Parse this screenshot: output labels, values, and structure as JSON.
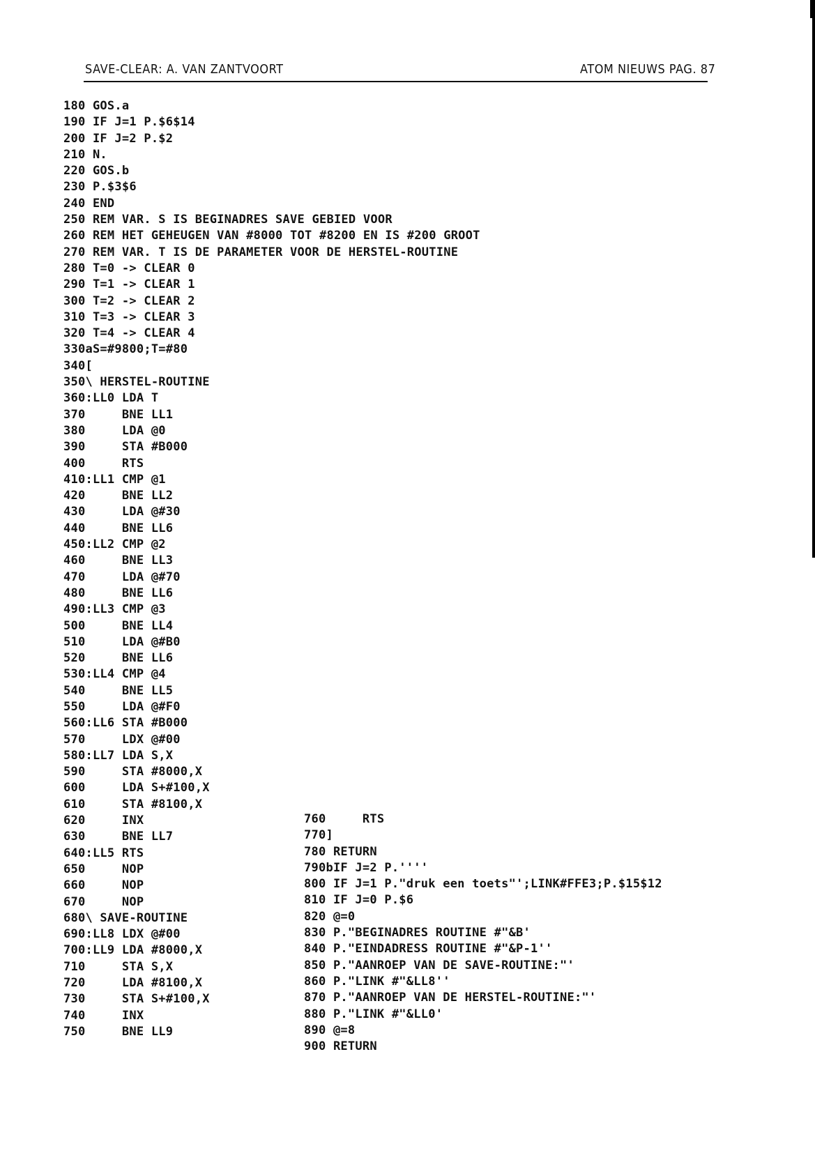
{
  "header": {
    "left": "SAVE-CLEAR: A. VAN ZANTVOORT",
    "right": "ATOM NIEUWS PAG. 87"
  },
  "listing_left": [
    "180 GOS.a",
    "190 IF J=1 P.$6$14",
    "200 IF J=2 P.$2",
    "210 N.",
    "220 GOS.b",
    "230 P.$3$6",
    "240 END",
    "250 REM VAR. S IS BEGINADRES SAVE GEBIED VOOR",
    "260 REM HET GEHEUGEN VAN #8000 TOT #8200 EN IS #200 GROOT",
    "270 REM VAR. T IS DE PARAMETER VOOR DE HERSTEL-ROUTINE",
    "280 T=0 -> CLEAR 0",
    "290 T=1 -> CLEAR 1",
    "300 T=2 -> CLEAR 2",
    "310 T=3 -> CLEAR 3",
    "320 T=4 -> CLEAR 4",
    "330aS=#9800;T=#80",
    "340[",
    "350\\ HERSTEL-ROUTINE",
    "360:LL0 LDA T",
    "370     BNE LL1",
    "380     LDA @0",
    "390     STA #B000",
    "400     RTS",
    "410:LL1 CMP @1",
    "420     BNE LL2",
    "430     LDA @#30",
    "440     BNE LL6",
    "450:LL2 CMP @2",
    "460     BNE LL3",
    "470     LDA @#70",
    "480     BNE LL6",
    "490:LL3 CMP @3",
    "500     BNE LL4",
    "510     LDA @#B0",
    "520     BNE LL6",
    "530:LL4 CMP @4",
    "540     BNE LL5",
    "550     LDA @#F0",
    "560:LL6 STA #B000",
    "570     LDX @#00",
    "580:LL7 LDA S,X",
    "590     STA #8000,X",
    "600     LDA S+#100,X",
    "610     STA #8100,X",
    "620     INX",
    "630     BNE LL7",
    "640:LL5 RTS",
    "650     NOP",
    "660     NOP",
    "670     NOP",
    "680\\ SAVE-ROUTINE",
    "690:LL8 LDX @#00",
    "700:LL9 LDA #8000,X",
    "710     STA S,X",
    "720     LDA #8100,X",
    "730     STA S+#100,X",
    "740     INX",
    "750     BNE LL9"
  ],
  "listing_right": [
    "760     RTS",
    "770]",
    "780 RETURN",
    "790bIF J=2 P.''''",
    "800 IF J=1 P.\"druk een toets\"';LINK#FFE3;P.$15$12",
    "810 IF J=0 P.$6",
    "820 @=0",
    "830 P.\"BEGINADRES ROUTINE #\"&B'",
    "840 P.\"EINDADRESS ROUTINE #\"&P-1''",
    "850 P.\"AANROEP VAN DE SAVE-ROUTINE:\"'",
    "860 P.\"LINK #\"&LL8''",
    "870 P.\"AANROEP VAN DE HERSTEL-ROUTINE:\"'",
    "880 P.\"LINK #\"&LL0'",
    "890 @=8",
    "900 RETURN"
  ]
}
